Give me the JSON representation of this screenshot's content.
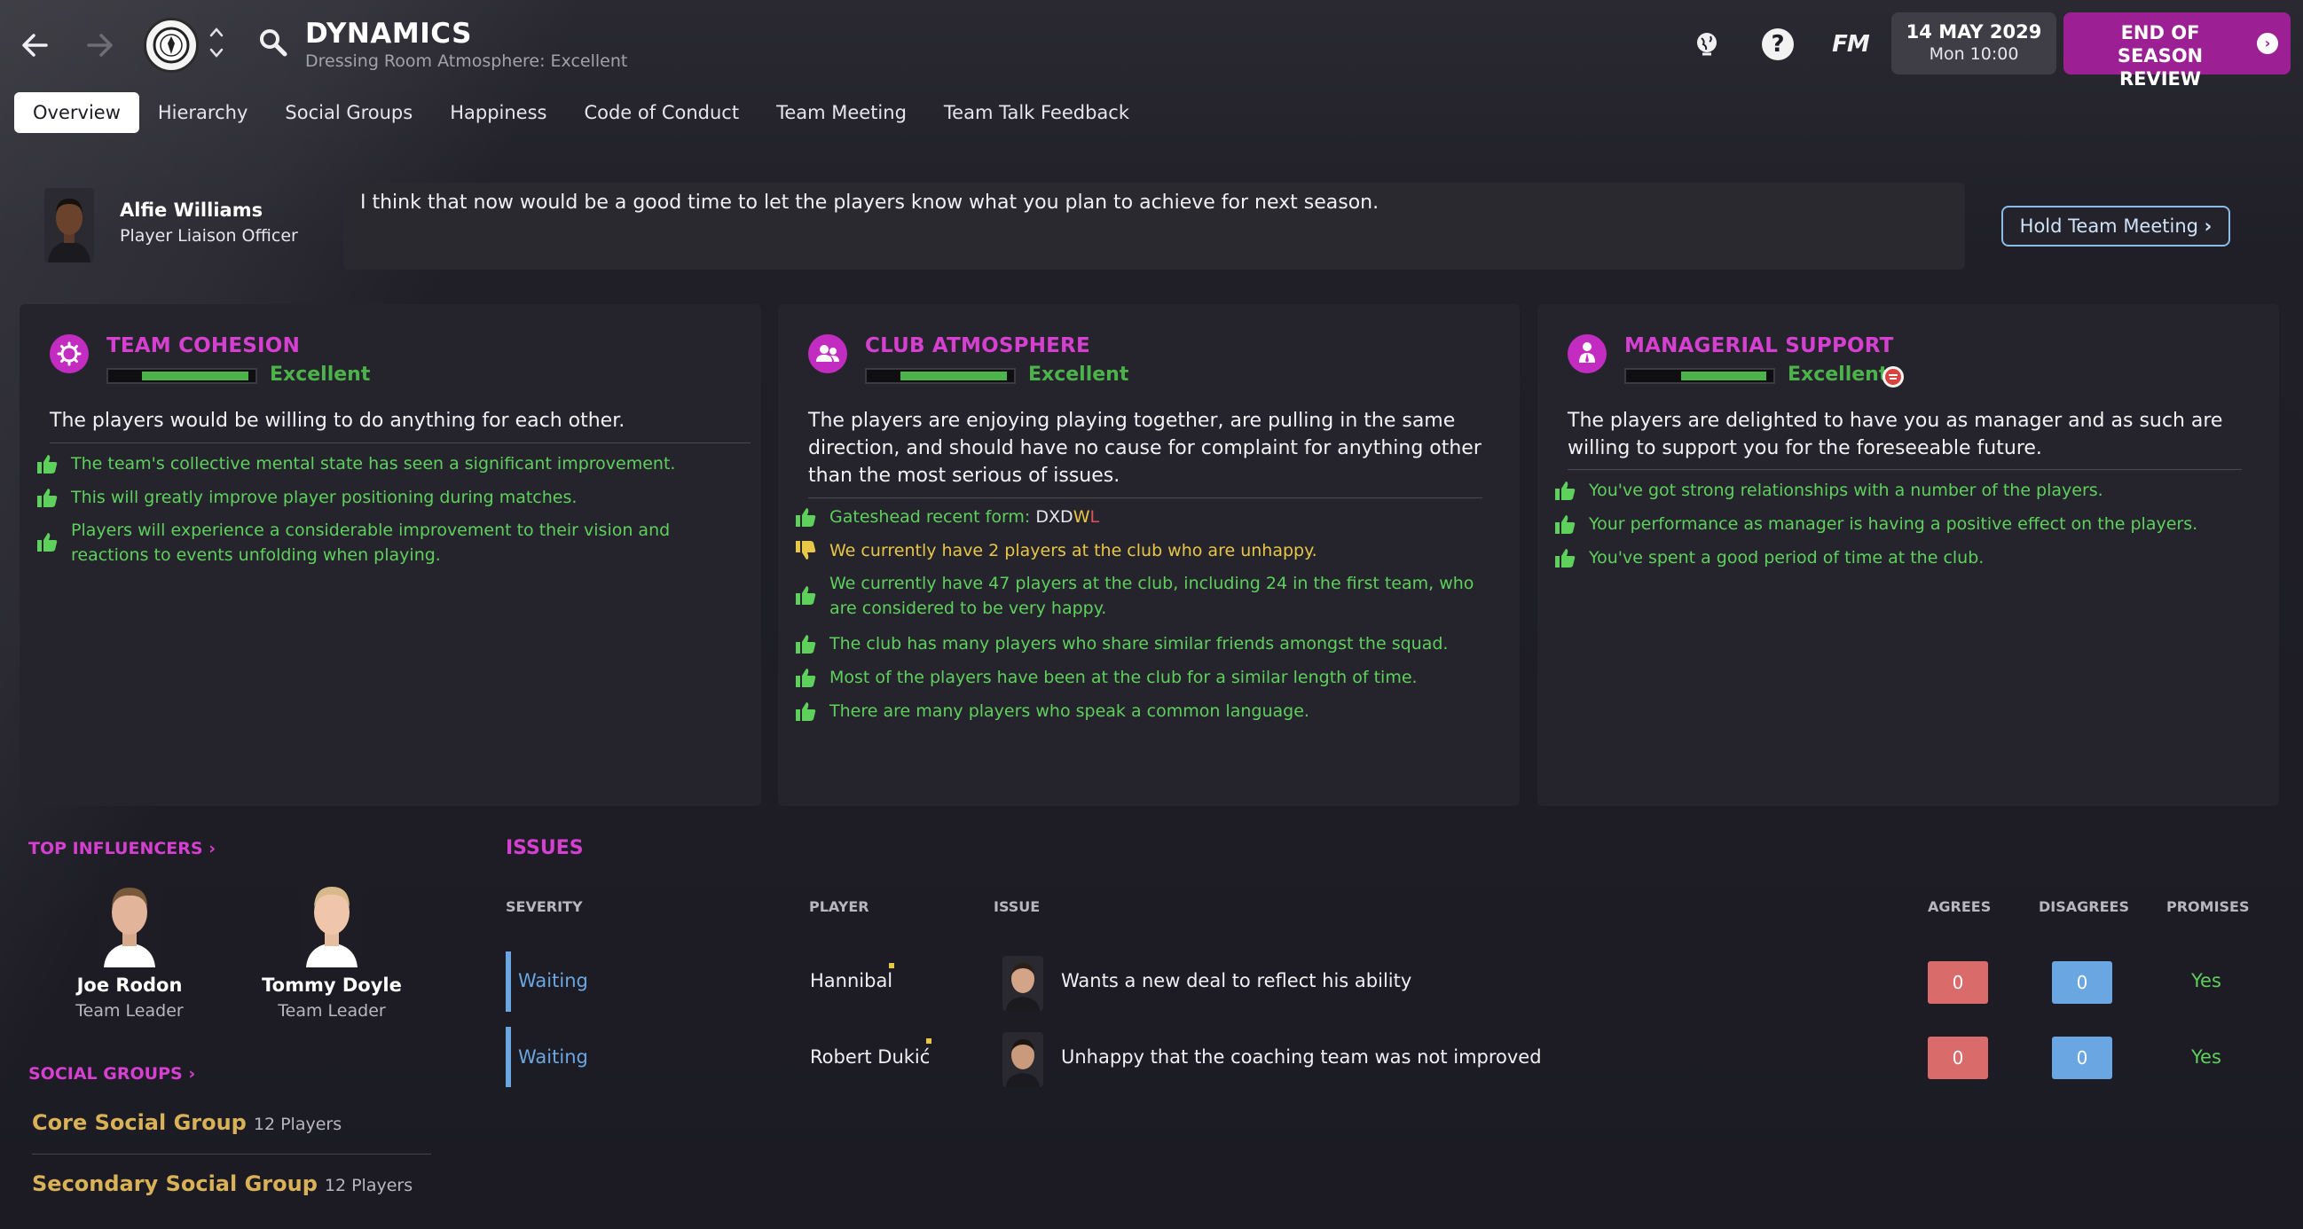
{
  "header": {
    "title": "DYNAMICS",
    "subtitle": "Dressing Room Atmosphere: Excellent",
    "date": "14 MAY 2029",
    "time": "Mon 10:00",
    "continue_label": "END OF SEASON REVIEW",
    "icons": [
      "back-arrow-icon",
      "forward-arrow-icon",
      "club-badge",
      "search-icon",
      "globe-icon",
      "help-icon",
      "fm-logo",
      "chevron-right-icon"
    ]
  },
  "tabs": [
    "Overview",
    "Hierarchy",
    "Social Groups",
    "Happiness",
    "Code of Conduct",
    "Team Meeting",
    "Team Talk Feedback"
  ],
  "active_tab": "Overview",
  "advisor": {
    "name": "Alfie Williams",
    "role": "Player Liaison Officer",
    "message": "I think that now would be a good time to let the players know what you plan to achieve for next season.",
    "button": "Hold Team Meeting"
  },
  "panels": {
    "cohesion": {
      "title": "TEAM COHESION",
      "rating": "Excellent",
      "level": 0.75,
      "description": "The players would be willing to do anything for each other.",
      "reasons": [
        "The team's collective mental state has seen a significant improvement.",
        "This will greatly improve player positioning during matches.",
        "Players will experience a considerable improvement to their vision and reactions to events unfolding when playing."
      ]
    },
    "atmosphere": {
      "title": "CLUB ATMOSPHERE",
      "rating": "Excellent",
      "level": 0.75,
      "description": "The players are enjoying playing together, are pulling in the same direction, and should have no cause for complaint for anything other than the most serious of issues.",
      "form_label": "Gateshead recent form: ",
      "form": [
        "D",
        "X",
        "D",
        "W",
        "L"
      ],
      "reasons": [
        "We currently have 2 players at the club who are unhappy.",
        "We currently have 47 players at the club, including 24 in the first team, who are considered to be very happy.",
        "The club has many players who share similar friends amongst the squad.",
        "Most of the players have been at the club for a similar length of time.",
        "There are many players who speak a common language."
      ]
    },
    "managerial": {
      "title": "MANAGERIAL SUPPORT",
      "rating": "Excellent",
      "level": 0.6,
      "description": "The players are delighted to have you as manager and as such are willing to support you for the foreseeable future.",
      "reasons": [
        "You've got strong relationships with a number of the players.",
        "Your performance as manager is having a positive effect on the players.",
        "You've spent a good period of time at the club."
      ]
    }
  },
  "influencers": {
    "title": "TOP INFLUENCERS",
    "players": [
      {
        "name": "Joe Rodon",
        "role": "Team Leader"
      },
      {
        "name": "Tommy Doyle",
        "role": "Team Leader"
      }
    ]
  },
  "social_groups": {
    "title": "SOCIAL GROUPS",
    "groups": [
      {
        "name": "Core Social Group",
        "count": "12 Players"
      },
      {
        "name": "Secondary Social Group",
        "count": "12 Players"
      }
    ]
  },
  "issues": {
    "title": "ISSUES",
    "columns": [
      "SEVERITY",
      "PLAYER",
      "ISSUE",
      "AGREES",
      "DISAGREES",
      "PROMISES"
    ],
    "rows": [
      {
        "severity": "Waiting",
        "player": "Hannibal",
        "issue": "Wants a new deal to reflect his ability",
        "agrees": "0",
        "disagrees": "0",
        "promises": "Yes"
      },
      {
        "severity": "Waiting",
        "player": "Robert Dukić",
        "issue": "Unhappy that the coaching team was not improved",
        "agrees": "0",
        "disagrees": "0",
        "promises": "Yes"
      }
    ]
  },
  "colors": {
    "accent": "#d540d0",
    "positive": "#5dd15b",
    "warning": "#e8c646",
    "severity": "#6aa7e2"
  }
}
